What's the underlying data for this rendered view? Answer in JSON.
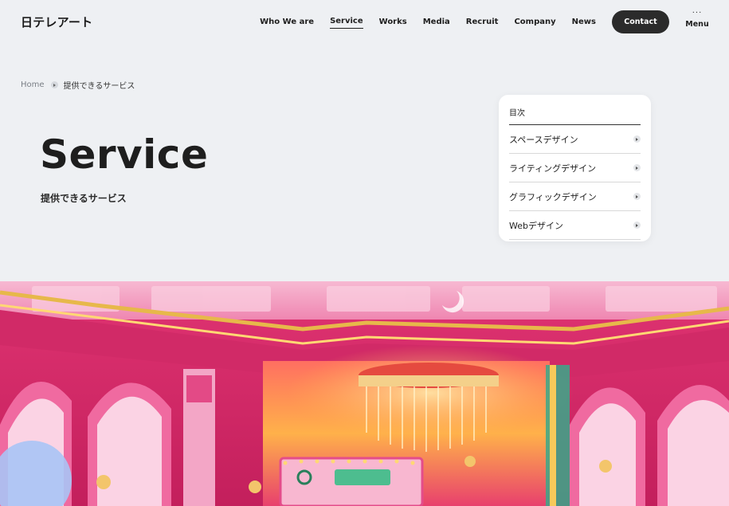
{
  "header": {
    "logo": "日テレアート",
    "nav": [
      {
        "label": "Who We are",
        "active": false
      },
      {
        "label": "Service",
        "active": true
      },
      {
        "label": "Works",
        "active": false
      },
      {
        "label": "Media",
        "active": false
      },
      {
        "label": "Recruit",
        "active": false
      },
      {
        "label": "Company",
        "active": false
      },
      {
        "label": "News",
        "active": false
      }
    ],
    "contact_label": "Contact",
    "menu_dots": "···",
    "menu_label": "Menu"
  },
  "breadcrumb": {
    "home": "Home",
    "current": "提供できるサービス"
  },
  "hero": {
    "title": "Service",
    "subtitle": "提供できるサービス"
  },
  "toc": {
    "title": "目次",
    "items": [
      {
        "label": "スペースデザイン"
      },
      {
        "label": "ライティングデザイン"
      },
      {
        "label": "グラフィックデザイン"
      },
      {
        "label": "Webデザイン"
      }
    ]
  },
  "colors": {
    "background": "#eef0f3",
    "text": "#1e1e1e",
    "contact_button": "#2b2b2b",
    "set_pink": "#e8347a",
    "set_light_pink": "#f4a3c4",
    "set_gold": "#e7b84a"
  },
  "icons": {
    "breadcrumb_separator": "chevron-right-icon",
    "toc_arrow": "chevron-right-icon",
    "menu": "more-dots-icon"
  }
}
